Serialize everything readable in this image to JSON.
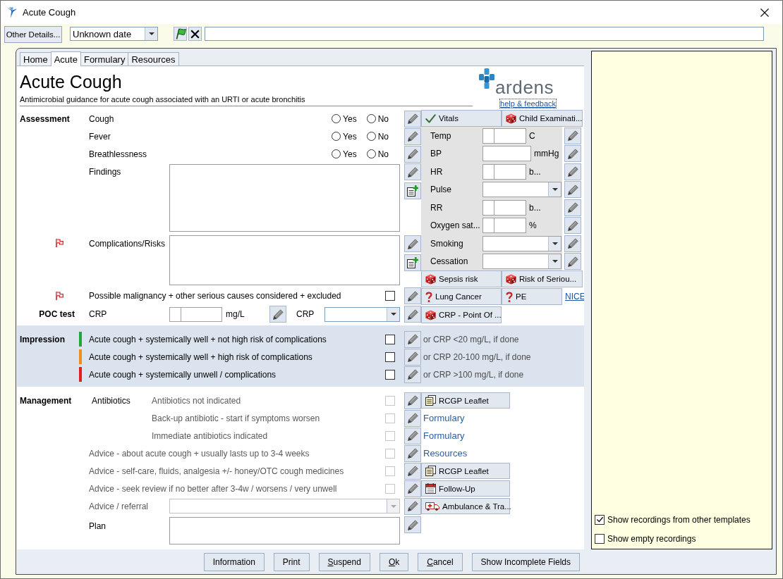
{
  "window": {
    "title": "Acute Cough"
  },
  "toolbar": {
    "details_button": "Other Details...",
    "date": {
      "value": "Unknown date"
    }
  },
  "tabs": [
    {
      "label": "Home",
      "selected": false
    },
    {
      "label": "Acute",
      "selected": true
    },
    {
      "label": "Formulary",
      "selected": false
    },
    {
      "label": "Resources",
      "selected": false
    }
  ],
  "header": {
    "title": "Acute Cough",
    "subtitle": "Antimicrobial guidance for acute cough associated with an URTI or acute bronchitis",
    "logo_text": "ardens",
    "help_link": "help & feedback"
  },
  "assessment": {
    "label": "Assessment",
    "rows": [
      {
        "kind": "radio",
        "label": "Cough",
        "flagged": false,
        "options": [
          {
            "label": "Yes",
            "selected": false
          },
          {
            "label": "No",
            "selected": false
          }
        ]
      },
      {
        "kind": "radio",
        "label": "Fever",
        "flagged": false,
        "options": [
          {
            "label": "Yes",
            "selected": false
          },
          {
            "label": "No",
            "selected": false
          }
        ]
      },
      {
        "kind": "radio",
        "label": "Breathlessness",
        "flagged": false,
        "options": [
          {
            "label": "Yes",
            "selected": false
          },
          {
            "label": "No",
            "selected": false
          }
        ]
      },
      {
        "kind": "notes",
        "label": "Findings",
        "flagged": false
      },
      {
        "kind": "notes",
        "label": "Complications/Risks",
        "flagged": true
      },
      {
        "kind": "check",
        "label": "Possible malignancy + other serious causes considered + excluded",
        "flagged": true,
        "checked": false
      }
    ]
  },
  "poc_test": {
    "label": "POC test",
    "test_label": "CRP",
    "unit": "mg/L",
    "result_label": "CRP"
  },
  "vitals_panel": {
    "buttons": [
      {
        "kind": "tick",
        "label": "Vitals"
      },
      {
        "kind": "protocol",
        "label": "Child Examinati..."
      }
    ],
    "rows": [
      {
        "kind": "split",
        "label": "Temp",
        "unit": "C"
      },
      {
        "kind": "text",
        "label": "BP",
        "unit": "mmHg"
      },
      {
        "kind": "split",
        "label": "HR",
        "unit": "b..."
      },
      {
        "kind": "dropdown",
        "label": "Pulse"
      },
      {
        "kind": "split",
        "label": "RR",
        "unit": "b..."
      },
      {
        "kind": "split",
        "label": "Oxygen sat...",
        "unit": "%"
      },
      {
        "kind": "dropdown",
        "label": "Smoking"
      },
      {
        "kind": "dropdown",
        "label": "Cessation"
      }
    ],
    "tool_rows": [
      {
        "buttons": [
          {
            "kind": "protocol",
            "label": "Sepsis risk"
          },
          {
            "kind": "protocol",
            "label": "Risk of Seriou..."
          }
        ]
      },
      {
        "buttons": [
          {
            "kind": "query",
            "label": "Lung Cancer"
          },
          {
            "kind": "query",
            "label": "PE"
          },
          {
            "kind": "link",
            "label": "NICE"
          }
        ]
      },
      {
        "buttons": [
          {
            "kind": "protocol",
            "label": "CRP - Point Of ..."
          }
        ]
      }
    ]
  },
  "impression": {
    "label": "Impression",
    "options": [
      {
        "label": "Acute cough + systemically well + not high risk of complications",
        "color": "#1fa834",
        "checked": false,
        "note": "or CRP <20 mg/L, if done"
      },
      {
        "label": "Acute cough + systemically well + high risk of complications",
        "color": "#f08c1c",
        "checked": false,
        "note": "or CRP 20-100 mg/L, if done"
      },
      {
        "label": "Acute cough + systemically unwell / complications",
        "color": "#e02020",
        "checked": false,
        "note": "or CRP >100 mg/L, if done"
      }
    ]
  },
  "management": {
    "label": "Management",
    "antibiotics_label": "Antibiotics",
    "antibiotics": [
      {
        "label": "Antibiotics not indicated",
        "checked": false,
        "disabled": true,
        "action": {
          "kind": "leaflet",
          "label": "RCGP Leaflet"
        }
      },
      {
        "label": "Back-up antibiotic - start if symptoms worsen",
        "checked": false,
        "disabled": true,
        "action": {
          "kind": "link",
          "label": "Formulary"
        }
      },
      {
        "label": "Immediate antibiotics indicated",
        "checked": false,
        "disabled": true,
        "action": {
          "kind": "link",
          "label": "Formulary"
        }
      }
    ],
    "advice": [
      {
        "label": "Advice - about acute cough + usually lasts up to 3-4 weeks",
        "checked": false,
        "disabled": true,
        "action": {
          "kind": "link",
          "label": "Resources"
        }
      },
      {
        "label": "Advice - self-care, fluids, analgesia +/- honey/OTC cough medicines",
        "checked": false,
        "disabled": true,
        "action": {
          "kind": "leaflet",
          "label": "RCGP Leaflet"
        }
      },
      {
        "label": "Advice - seek review if no better after 3-4w / worsens / very unwell",
        "checked": false,
        "disabled": true,
        "action": {
          "kind": "calendar",
          "label": "Follow-Up"
        }
      }
    ],
    "referral": {
      "label": "Advice / referral",
      "disabled": true,
      "action": {
        "kind": "ambulance",
        "label": "Ambulance & Tra..."
      }
    },
    "plan": {
      "label": "Plan"
    }
  },
  "footer_buttons": [
    {
      "label": "Information",
      "access_key": false
    },
    {
      "label": "Print",
      "access_key": false
    },
    {
      "label": "Suspend",
      "access_key": true
    },
    {
      "label": "Ok",
      "access_key": true
    },
    {
      "label": "Cancel",
      "access_key": true
    },
    {
      "label": "Show Incomplete Fields",
      "access_key": false
    }
  ],
  "side_panel": {
    "options": [
      {
        "label": "Show recordings from other templates",
        "checked": true
      },
      {
        "label": "Show empty recordings",
        "checked": false
      }
    ]
  }
}
